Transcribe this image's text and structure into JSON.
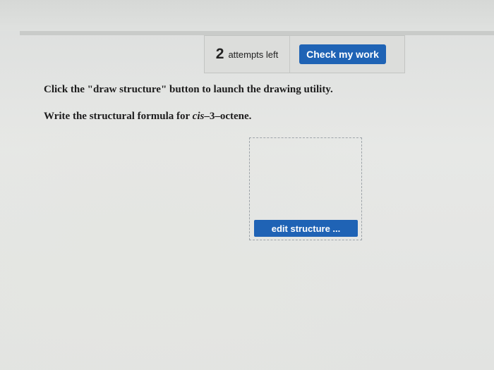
{
  "attempts": {
    "count": "2",
    "label": "attempts left"
  },
  "header": {
    "check_label": "Check my work"
  },
  "main": {
    "instruction": "Click the \"draw structure\" button to launch the drawing utility.",
    "question_prefix": "Write the structural formula for ",
    "question_compound_italic": "cis",
    "question_suffix": "–3–octene."
  },
  "draw": {
    "edit_label": "edit structure ..."
  },
  "colors": {
    "button_blue": "#1f63b5"
  }
}
